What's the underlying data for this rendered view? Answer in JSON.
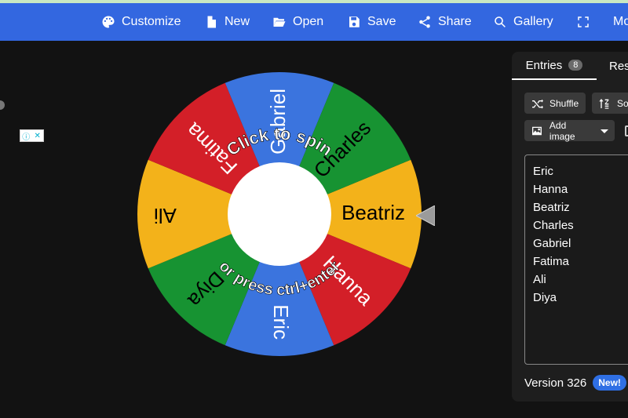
{
  "toolbar": {
    "customize": "Customize",
    "new": "New",
    "open": "Open",
    "save": "Save",
    "share": "Share",
    "gallery": "Gallery",
    "more": "Mo"
  },
  "wheel": {
    "segments": [
      {
        "label": "Beatriz",
        "color": "#f3b21a"
      },
      {
        "label": "Hanna",
        "color": "#d31f28"
      },
      {
        "label": "Eric",
        "color": "#3b74de"
      },
      {
        "label": "Diya",
        "color": "#179332"
      },
      {
        "label": "Ali",
        "color": "#f3b21a"
      },
      {
        "label": "Fatima",
        "color": "#d31f28"
      },
      {
        "label": "Gabriel",
        "color": "#3b74de"
      },
      {
        "label": "Charles",
        "color": "#179332"
      }
    ],
    "hint_top": "Click to spin",
    "hint_bottom": "or press ctrl+enter"
  },
  "ad": {
    "info": "ⓘ",
    "close": "✕"
  },
  "panel": {
    "tab_entries": "Entries",
    "entries_count": "8",
    "tab_results": "Res",
    "shuffle": "Shuffle",
    "sort": "So",
    "add_image": "Add image",
    "entries": [
      "Eric",
      "Hanna",
      "Beatriz",
      "Charles",
      "Gabriel",
      "Fatima",
      "Ali",
      "Diya"
    ],
    "version": "Version 326",
    "new_badge": "New!"
  }
}
